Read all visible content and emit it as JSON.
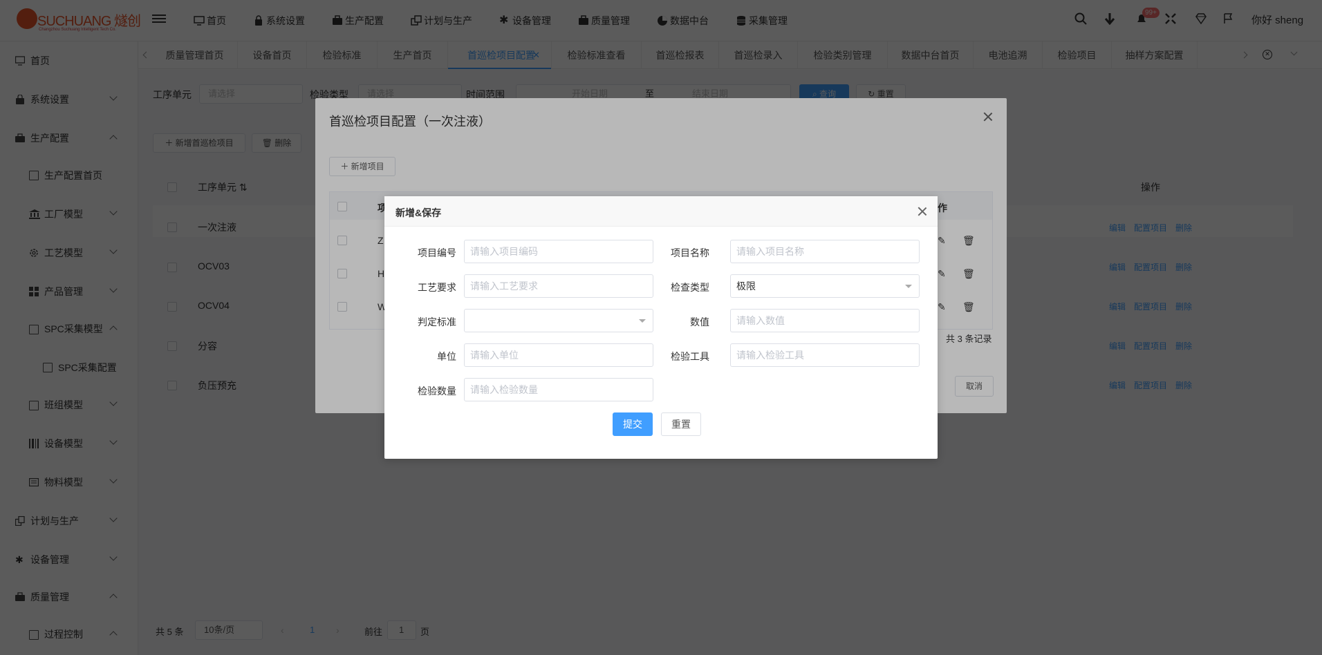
{
  "header": {
    "brand": "SUCHUANG 燧创",
    "brand_tagline": "Changzhou Suchuang Intelligent Tech Co.",
    "nav": [
      "首页",
      "系统设置",
      "生产配置",
      "计划与生产",
      "设备管理",
      "质量管理",
      "数据中台",
      "采集管理"
    ],
    "badge": "99+",
    "greeting": "你好 sheng"
  },
  "sidebar": {
    "items": [
      {
        "label": "首页",
        "icon": "monitor-icon"
      },
      {
        "label": "系统设置",
        "icon": "lock-icon"
      },
      {
        "label": "生产配置",
        "icon": "briefcase-icon"
      },
      {
        "label": "生产配置首页",
        "icon": "document-icon"
      },
      {
        "label": "工厂模型",
        "icon": "bank-icon"
      },
      {
        "label": "工艺模型",
        "icon": "gear-icon"
      },
      {
        "label": "产品管理",
        "icon": "grid-icon"
      },
      {
        "label": "SPC采集模型",
        "icon": "folder-icon"
      },
      {
        "label": "SPC采集配置",
        "icon": "document-icon"
      },
      {
        "label": "班组模型",
        "icon": "folder-icon"
      },
      {
        "label": "设备模型",
        "icon": "barcode-icon"
      },
      {
        "label": "物料模型",
        "icon": "card-icon"
      },
      {
        "label": "计划与生产",
        "icon": "copy-icon"
      },
      {
        "label": "设备管理",
        "icon": "asterisk-icon"
      },
      {
        "label": "质量管理",
        "icon": "briefcase-icon"
      },
      {
        "label": "过程控制",
        "icon": "folder-icon"
      }
    ]
  },
  "tabs": [
    "质量管理首页",
    "设备首页",
    "检验标准",
    "生产首页",
    "首巡检项目配置",
    "检验标准查看",
    "首巡检报表",
    "首巡检录入",
    "检验类别管理",
    "数据中台首页",
    "电池追溯",
    "检验项目",
    "抽样方案配置"
  ],
  "active_tab": "首巡检项目配置",
  "filters": {
    "process_unit_label": "工序单元",
    "process_unit_placeholder": "请选择",
    "inspect_type_label": "检验类型",
    "inspect_type_placeholder": "请选择",
    "time_range_label": "时间范围",
    "start_placeholder": "开始日期",
    "to": "至",
    "end_placeholder": "结束日期",
    "search": "查询",
    "reset": "重置"
  },
  "toolbar": {
    "add": "新增首巡检项目",
    "delete": "删除"
  },
  "table": {
    "col_unit": "工序单元",
    "col_ops": "操作",
    "rows": [
      "一次注液",
      "OCV03",
      "OCV04",
      "分容",
      "负压预充"
    ],
    "ops": [
      "编辑",
      "配置项目",
      "删除"
    ]
  },
  "pagination": {
    "total": "共 5 条",
    "size": "10条/页",
    "page": "1",
    "goto": "前往",
    "page_input": "1",
    "page_suffix": "页"
  },
  "dialog1": {
    "title": "首巡检项目配置（一次注液）",
    "add": "新增项目",
    "col_item": "项",
    "col_ops": "作",
    "row_prefixes": [
      "Z",
      "H",
      "W"
    ],
    "total": "共 3 条记录",
    "cancel": "取消"
  },
  "dialog2": {
    "title": "新增&保存",
    "fields": {
      "code_label": "项目编号",
      "code_ph": "请输入项目编码",
      "name_label": "项目名称",
      "name_ph": "请输入项目名称",
      "req_label": "工艺要求",
      "req_ph": "请输入工艺要求",
      "type_label": "检查类型",
      "type_value": "极限",
      "std_label": "判定标准",
      "value_label": "数值",
      "value_ph": "请输入数值",
      "unit_label": "单位",
      "unit_ph": "请输入单位",
      "tool_label": "检验工具",
      "tool_ph": "请输入检验工具",
      "qty_label": "检验数量",
      "qty_ph": "请输入检验数量"
    },
    "submit": "提交",
    "reset": "重置"
  }
}
